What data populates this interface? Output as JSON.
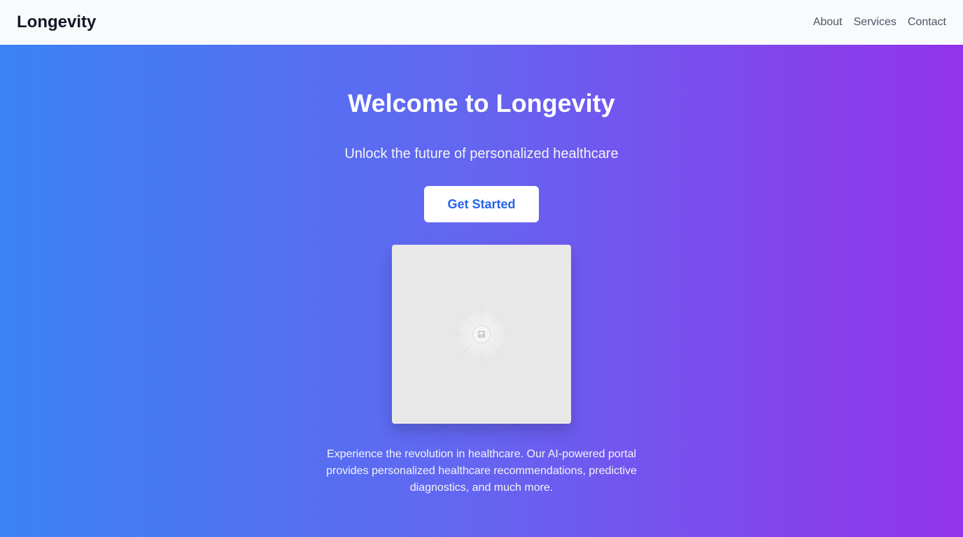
{
  "navbar": {
    "brand": "Longevity",
    "links": [
      {
        "label": "About"
      },
      {
        "label": "Services"
      },
      {
        "label": "Contact"
      }
    ]
  },
  "hero": {
    "title": "Welcome to Longevity",
    "subtitle": "Unlock the future of personalized healthcare",
    "cta_label": "Get Started",
    "image_icon": "image-placeholder-icon",
    "description": "Experience the revolution in healthcare. Our AI-powered portal provides personalized healthcare recommendations, predictive diagnostics, and much more."
  },
  "colors": {
    "gradient_start": "#3b82f6",
    "gradient_end": "#9333ea",
    "cta_text": "#2563eb",
    "nav_background": "#f8fafc"
  }
}
